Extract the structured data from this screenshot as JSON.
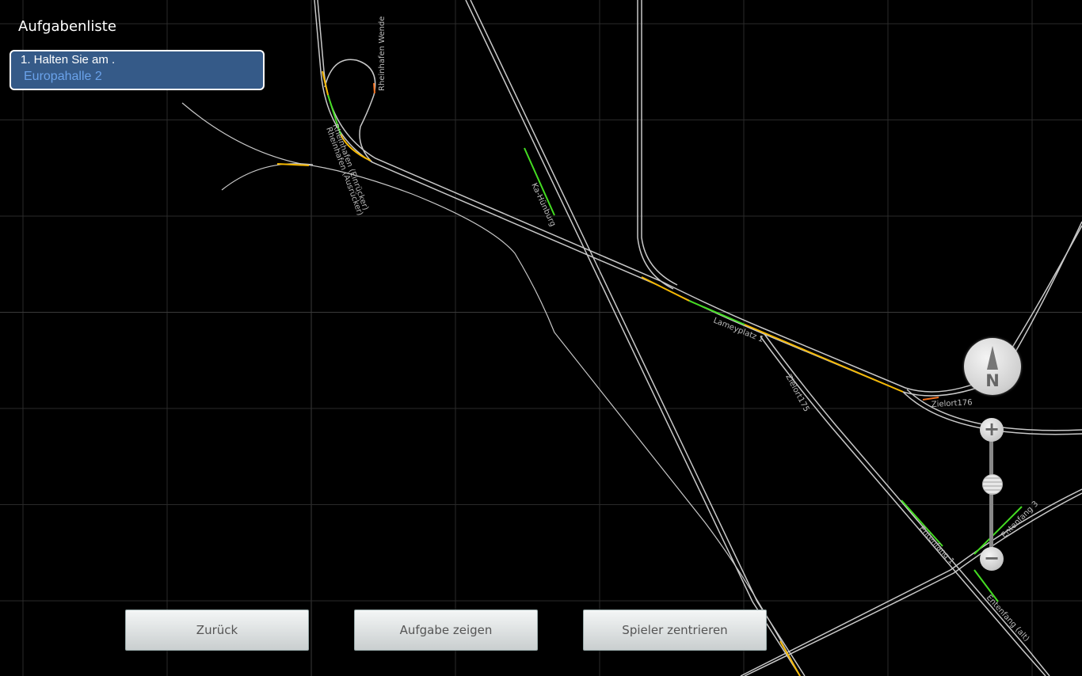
{
  "panel": {
    "title": "Aufgabenliste",
    "tasks": [
      {
        "line1": "1. Halten Sie am .",
        "line2": "Europahalle 2"
      }
    ]
  },
  "buttons": {
    "back": "Zurück",
    "show_task": "Aufgabe zeigen",
    "center_player": "Spieler zentrieren"
  },
  "map": {
    "labels": {
      "rheinhafen_wende": "Rheinhafen Wende",
      "rheinhafen_ein": "Rheinhafen (Einrücker)",
      "rheinhafen_aus": "Rheinhafen (Ausrücker)",
      "ka_stop": "Ka-Hünburg",
      "lameyplatz": "Lameyplatz 1",
      "zielort175": "Zielort175",
      "zielort176": "Zielort176",
      "entenfang1": "Entenfang 1",
      "entenfang3": "Entenfang 3",
      "entenfang_alt": "Entenfang (alt)"
    },
    "compass_label": "N",
    "zoom_in": "+",
    "zoom_out": "−",
    "colors": {
      "track": "#c8c8c8",
      "free": "#44dd22",
      "warn": "#f5b800",
      "alert": "#f07020",
      "grid": "#2a2a2a"
    }
  }
}
